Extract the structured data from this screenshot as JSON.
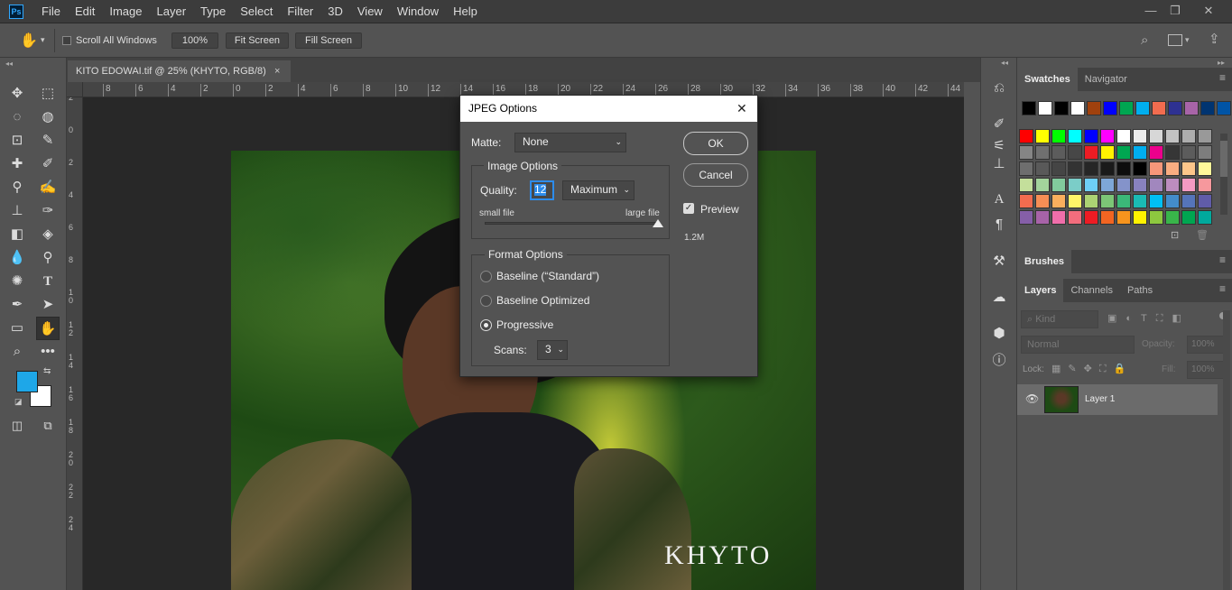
{
  "app_logo": "Ps",
  "menu": [
    "File",
    "Edit",
    "Image",
    "Layer",
    "Type",
    "Select",
    "Filter",
    "3D",
    "View",
    "Window",
    "Help"
  ],
  "options": {
    "scroll_all": "Scroll All Windows",
    "zoom": "100%",
    "fit": "Fit Screen",
    "fill": "Fill Screen"
  },
  "doc_tab": "KITO EDOWAI.tif @ 25% (KHYTO, RGB/8)",
  "doc_tab_close": "×",
  "ruler_top": [
    "8",
    "6",
    "4",
    "2",
    "0",
    "2",
    "4",
    "6",
    "8",
    "10",
    "12",
    "14",
    "16",
    "18",
    "20",
    "22",
    "24",
    "26",
    "28",
    "30",
    "32",
    "34",
    "36",
    "38",
    "40",
    "42",
    "44"
  ],
  "ruler_left": [
    "2",
    "0",
    "2",
    "4",
    "6",
    "8",
    "1\n0",
    "1\n2",
    "1\n4",
    "1\n6",
    "1\n8",
    "2\n0",
    "2\n2",
    "2\n4"
  ],
  "watermark": "KHYTO",
  "dialog": {
    "title": "JPEG Options",
    "close": "✕",
    "matte_label": "Matte:",
    "matte_value": "None",
    "image_options": "Image Options",
    "quality_label": "Quality:",
    "quality_value": "12",
    "quality_preset": "Maximum",
    "small_file": "small file",
    "large_file": "large file",
    "quality_slider": 1.0,
    "format_options": "Format Options",
    "baseline_standard": "Baseline (“Standard”)",
    "baseline_optimized": "Baseline Optimized",
    "progressive": "Progressive",
    "scans_label": "Scans:",
    "scans_value": "3",
    "ok": "OK",
    "cancel": "Cancel",
    "preview": "Preview",
    "file_size": "1.2M"
  },
  "panels": {
    "swatches_tab": "Swatches",
    "navigator_tab": "Navigator",
    "brushes_tab": "Brushes",
    "layers_tab": "Layers",
    "channels_tab": "Channels",
    "paths_tab": "Paths",
    "kind_placeholder": "Kind",
    "blend_mode": "Normal",
    "opacity_label": "Opacity:",
    "opacity_value": "100%",
    "lock_label": "Lock:",
    "fill_label": "Fill:",
    "fill_value": "100%",
    "layer_name": "Layer 1"
  },
  "colors": {
    "foreground": "#1ea7e8",
    "background": "#ffffff",
    "swatch_row1": [
      "#000000",
      "#ffffff",
      "#000000",
      "#ffffff",
      "#a0410d",
      "#0000ff",
      "#00a651",
      "#00aeef",
      "#f26c4f",
      "#2e3192",
      "#a864a8",
      "#003471",
      "#0054a6"
    ],
    "swatch_rows": [
      [
        "#ff0000",
        "#ffff00",
        "#00ff00",
        "#00ffff",
        "#0000ff",
        "#ff00ff",
        "#ffffff",
        "#ebebeb",
        "#d7d7d7",
        "#c2c2c2",
        "#adadad",
        "#999999"
      ],
      [
        "#858585",
        "#707070",
        "#5c5c5c",
        "#474747",
        "#ed1c24",
        "#fff200",
        "#00a651",
        "#00aeef",
        "#ec008c",
        "#363636",
        "#5c5c5c",
        "#7d7d7d"
      ],
      [
        "#6e6e6e",
        "#595959",
        "#454545",
        "#333333",
        "#262626",
        "#1a1a1a",
        "#0d0d0d",
        "#000000",
        "#f7977a",
        "#f9ad81",
        "#fdc68a",
        "#fff79a"
      ],
      [
        "#c4df9b",
        "#a3d39c",
        "#82ca9d",
        "#7bcdc8",
        "#6ecff6",
        "#7ea7d8",
        "#8493ca",
        "#8882be",
        "#a187be",
        "#bc8dbf",
        "#f49ac2",
        "#f6989d"
      ],
      [
        "#f26c4f",
        "#f68e55",
        "#fbaf5d",
        "#fff568",
        "#acd373",
        "#7cc576",
        "#3bb878",
        "#1abbb4",
        "#00bff3",
        "#438cca",
        "#5574b9",
        "#605ca8"
      ],
      [
        "#855fa8",
        "#a763a8",
        "#f06eaa",
        "#f26d7d",
        "#ed1c24",
        "#f26522",
        "#f7941d",
        "#fff200",
        "#8dc73f",
        "#39b54a",
        "#00a651",
        "#00a99d"
      ]
    ]
  }
}
